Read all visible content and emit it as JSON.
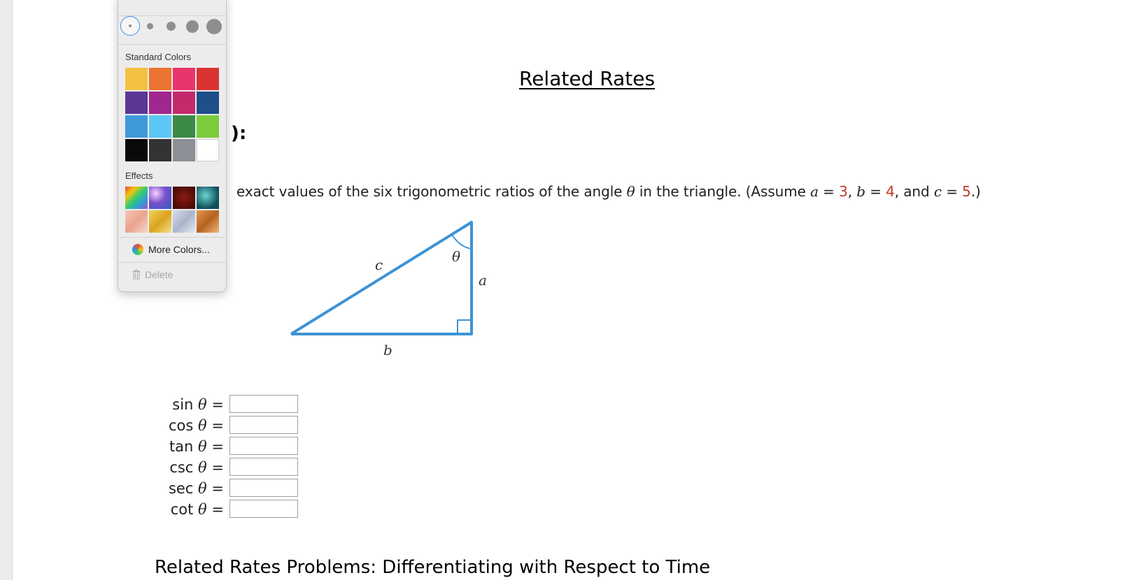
{
  "document": {
    "title": "Related Rates",
    "heading_fragment": "):",
    "problem": {
      "text_before": "exact values of the six trigonometric ratios of the angle ",
      "theta": "θ",
      "text_middle": " in the triangle. (Assume ",
      "a_label": "a",
      "a_value": "3",
      "b_label": "b",
      "b_value": "4",
      "c_label": "c",
      "c_value": "5",
      "eq": " = ",
      "comma": ", ",
      "and": ", and ",
      "close": ".)"
    },
    "triangle": {
      "labels": {
        "hyp": "c",
        "vertical": "a",
        "base": "b",
        "angle": "θ"
      },
      "color": "#3d93d6"
    },
    "ratios": [
      {
        "fn": "sin",
        "theta": "θ",
        "eq": "=",
        "value": ""
      },
      {
        "fn": "cos",
        "theta": "θ",
        "eq": "=",
        "value": ""
      },
      {
        "fn": "tan",
        "theta": "θ",
        "eq": "=",
        "value": ""
      },
      {
        "fn": "csc",
        "theta": "θ",
        "eq": "=",
        "value": ""
      },
      {
        "fn": "sec",
        "theta": "θ",
        "eq": "=",
        "value": ""
      },
      {
        "fn": "cot",
        "theta": "θ",
        "eq": "=",
        "value": ""
      }
    ],
    "bottom_heading": "Related Rates Problems:  Differentiating with Respect to Time"
  },
  "color_popup": {
    "standard_colors_label": "Standard Colors",
    "standard_colors": [
      "#f4c042",
      "#ec7330",
      "#e8356c",
      "#d93432",
      "#5b3795",
      "#a0278f",
      "#c4296c",
      "#1f4e8a",
      "#3c9bd8",
      "#5cc7f5",
      "#3a8a45",
      "#7ccb3d",
      "#0a0a0a",
      "#333333",
      "#8a9096",
      "#ffffff"
    ],
    "effects_label": "Effects",
    "effects": [
      "rainbow-effect",
      "sparkle-effect",
      "dark-red-effect",
      "teal-marble-effect",
      "peach-effect",
      "gold-effect",
      "silver-effect",
      "copper-effect"
    ],
    "more_colors_label": "More Colors...",
    "delete_label": "Delete"
  }
}
